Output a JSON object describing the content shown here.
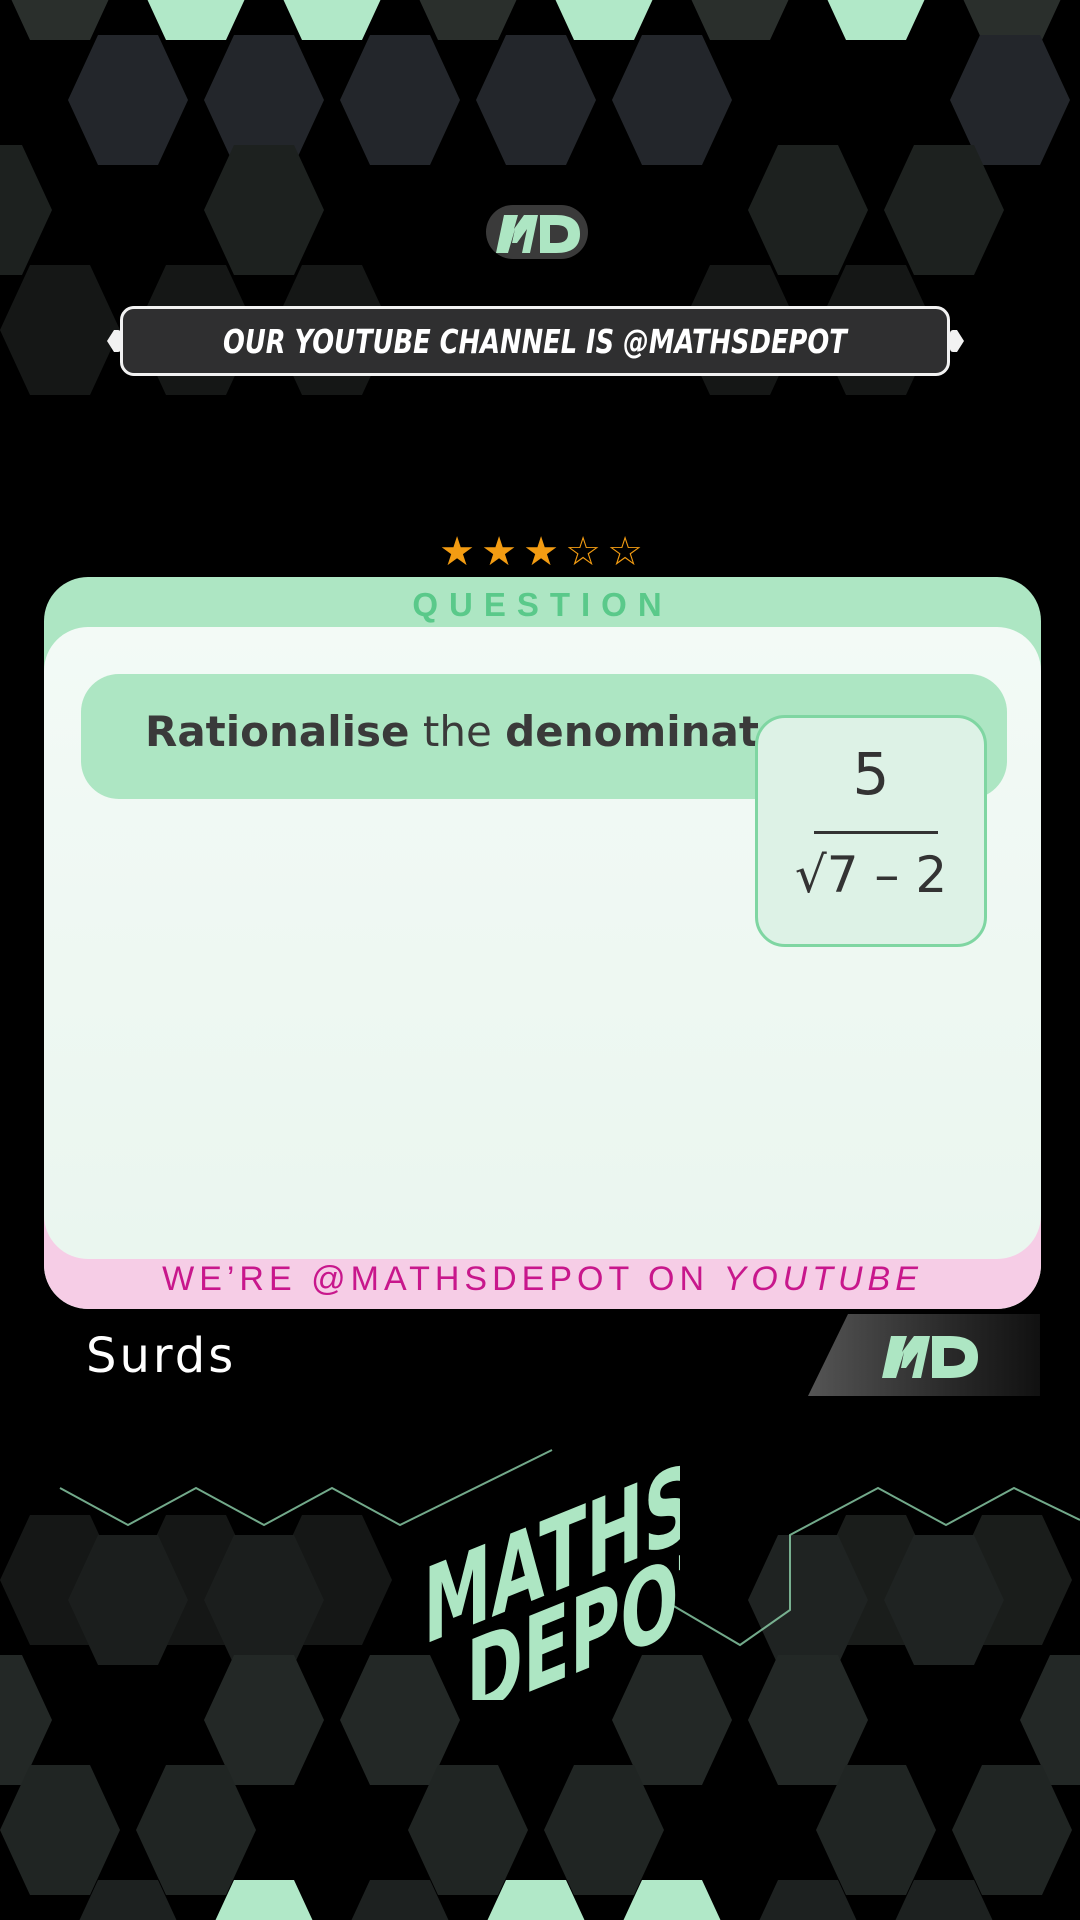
{
  "banner": {
    "text": "OUR YOUTUBE CHANNEL IS @MATHSDEPOT"
  },
  "rating": {
    "value": 3,
    "max": 5,
    "color": "#f39c12"
  },
  "card": {
    "header": "QUESTION",
    "footer_prefix": "WE’RE @MATHSDEPOT ON ",
    "footer_emph": "YOUTUBE",
    "instruction_bold1": "Rationalise",
    "instruction_mid": " the ",
    "instruction_bold2": "denominator",
    "instruction_end": "...",
    "fraction": {
      "numerator": "5",
      "denominator_radical": "√7",
      "denominator_rest": " – 2"
    }
  },
  "topic": "Surds",
  "brand": {
    "logo_text": "MD",
    "big_line1": "MATHS",
    "big_line2": "DEPOT",
    "accent": "#ade6c3"
  }
}
